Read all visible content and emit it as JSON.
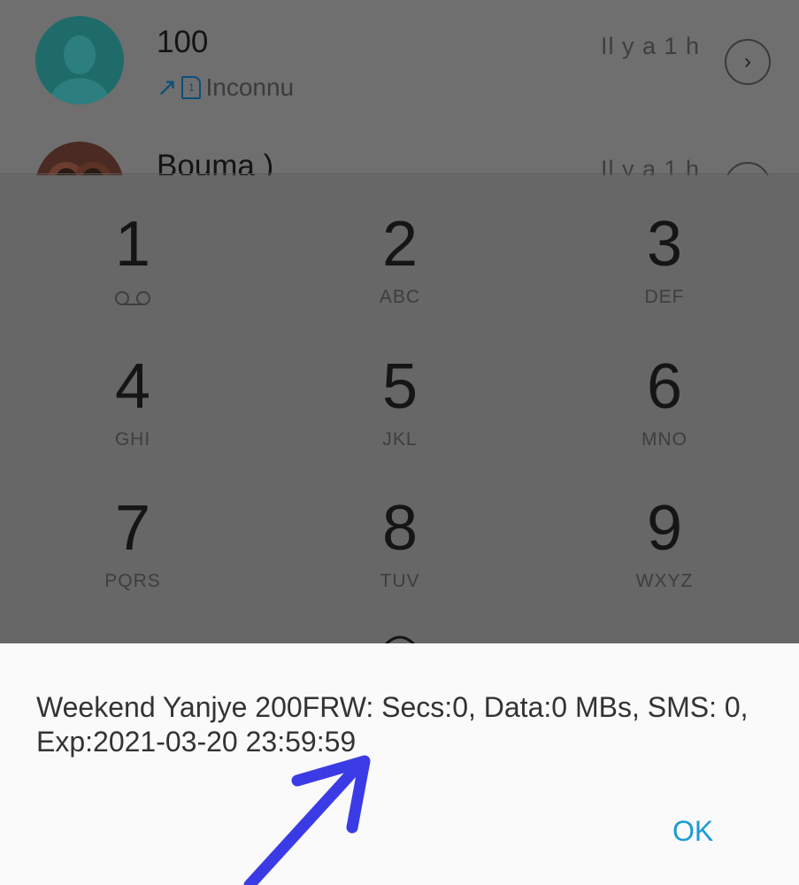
{
  "call_log": {
    "entries": [
      {
        "name": "100",
        "subtitle": "Inconnu",
        "time": "Il y a 1 h",
        "direction_icon": "outgoing-arrow-icon",
        "sim_label": "1"
      },
      {
        "name": "Bouma )",
        "time": "Il y a 1 h"
      }
    ]
  },
  "dialpad": {
    "keys": [
      {
        "digit": "1",
        "letters": "",
        "icon": "voicemail-icon"
      },
      {
        "digit": "2",
        "letters": "ABC"
      },
      {
        "digit": "3",
        "letters": "DEF"
      },
      {
        "digit": "4",
        "letters": "GHI"
      },
      {
        "digit": "5",
        "letters": "JKL"
      },
      {
        "digit": "6",
        "letters": "MNO"
      },
      {
        "digit": "7",
        "letters": "PQRS"
      },
      {
        "digit": "8",
        "letters": "TUV"
      },
      {
        "digit": "9",
        "letters": "WXYZ"
      }
    ]
  },
  "dialog": {
    "message": "Weekend Yanjye 200FRW: Secs:0, Data:0 MBs, SMS: 0, Exp:2021-03-20 23:59:59",
    "ok_label": "OK"
  },
  "colors": {
    "accent": "#1a9ad6",
    "annotation_arrow": "#3b3be6",
    "scrim": "#676767",
    "avatar_teal": "#1f6b6a"
  }
}
